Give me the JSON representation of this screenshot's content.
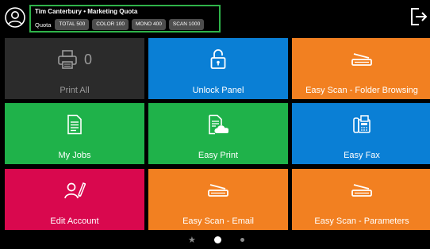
{
  "header": {
    "user_title": "Tim Canterbury • Marketing Quota",
    "quota_label": "Quota",
    "quota_items": [
      "TOTAL 500",
      "COLOR 100",
      "MONO 400",
      "SCAN 1000"
    ]
  },
  "tiles": {
    "print_all": {
      "label": "Print All",
      "count": "0"
    },
    "unlock_panel": {
      "label": "Unlock Panel"
    },
    "easy_scan_folder": {
      "label": "Easy Scan - Folder Browsing"
    },
    "my_jobs": {
      "label": "My Jobs"
    },
    "easy_print": {
      "label": "Easy Print"
    },
    "easy_fax": {
      "label": "Easy Fax"
    },
    "edit_account": {
      "label": "Edit Account"
    },
    "easy_scan_email": {
      "label": "Easy Scan - Email"
    },
    "easy_scan_params": {
      "label": "Easy Scan - Parameters"
    }
  },
  "pager": {
    "pages": 3,
    "active_page": 2
  },
  "colors": {
    "quota_border": "#2fb34a",
    "tile_dark": "#2b2b2b",
    "tile_blue": "#0a7fd5",
    "tile_orange": "#f28021",
    "tile_green": "#1fb24a",
    "tile_crimson": "#d9084e"
  }
}
